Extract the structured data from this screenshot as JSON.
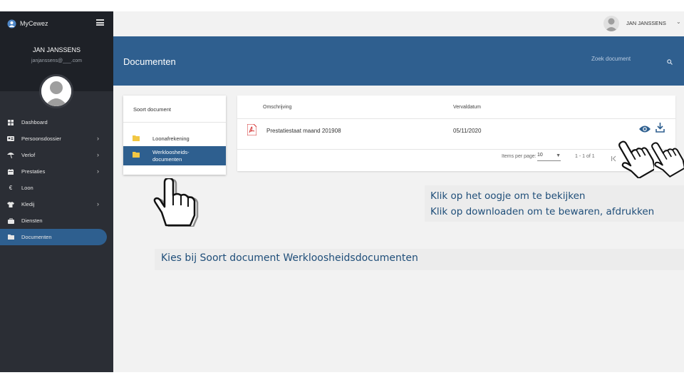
{
  "app": {
    "name": "MyCewez"
  },
  "sidebar": {
    "user_name": "JAN JANSSENS",
    "user_email": "janjanssens@___.com",
    "items": [
      {
        "label": "Dashboard",
        "icon": "dashboard-icon",
        "has_submenu": false
      },
      {
        "label": "Persoonsdossier",
        "icon": "id-card-icon",
        "has_submenu": true
      },
      {
        "label": "Verlof",
        "icon": "beach-umbrella-icon",
        "has_submenu": true
      },
      {
        "label": "Prestaties",
        "icon": "calendar-icon",
        "has_submenu": true
      },
      {
        "label": "Loon",
        "icon": "euro-icon",
        "has_submenu": false
      },
      {
        "label": "Kledij",
        "icon": "shirt-icon",
        "has_submenu": true
      },
      {
        "label": "Diensten",
        "icon": "briefcase-icon",
        "has_submenu": false
      },
      {
        "label": "Documenten",
        "icon": "folder-icon",
        "has_submenu": false,
        "active": true
      }
    ]
  },
  "topbar": {
    "user_name": "JAN JANSSENS",
    "caret": "⌄"
  },
  "header": {
    "title": "Documenten",
    "search_placeholder": "Zoek document"
  },
  "doc_types": {
    "title": "Soort document",
    "items": [
      {
        "label": "Loonafrekening",
        "selected": false
      },
      {
        "label": "Werkloosheids-\ndocumenten",
        "selected": true
      }
    ]
  },
  "table": {
    "headers": {
      "description": "Omschrijving",
      "expiry": "Vervaldatum"
    },
    "rows": [
      {
        "description": "Prestatiestaat maand 201908",
        "expiry": "05/11/2020"
      }
    ],
    "pagination": {
      "items_per_page_label": "Items per page:",
      "items_per_page": "10",
      "range": "1 - 1 of 1"
    }
  },
  "callouts": {
    "line1": "Klik op het oogje om te bekijken",
    "line2": "Klik op downloaden om te bewaren, afdrukken",
    "line3": "Kies bij Soort document Werkloosheidsdocumenten"
  },
  "colors": {
    "primary": "#2f5f8f",
    "sidebar": "#2b2e35",
    "pdf_red": "#d32f2f",
    "callout_text": "#1f4e79"
  }
}
